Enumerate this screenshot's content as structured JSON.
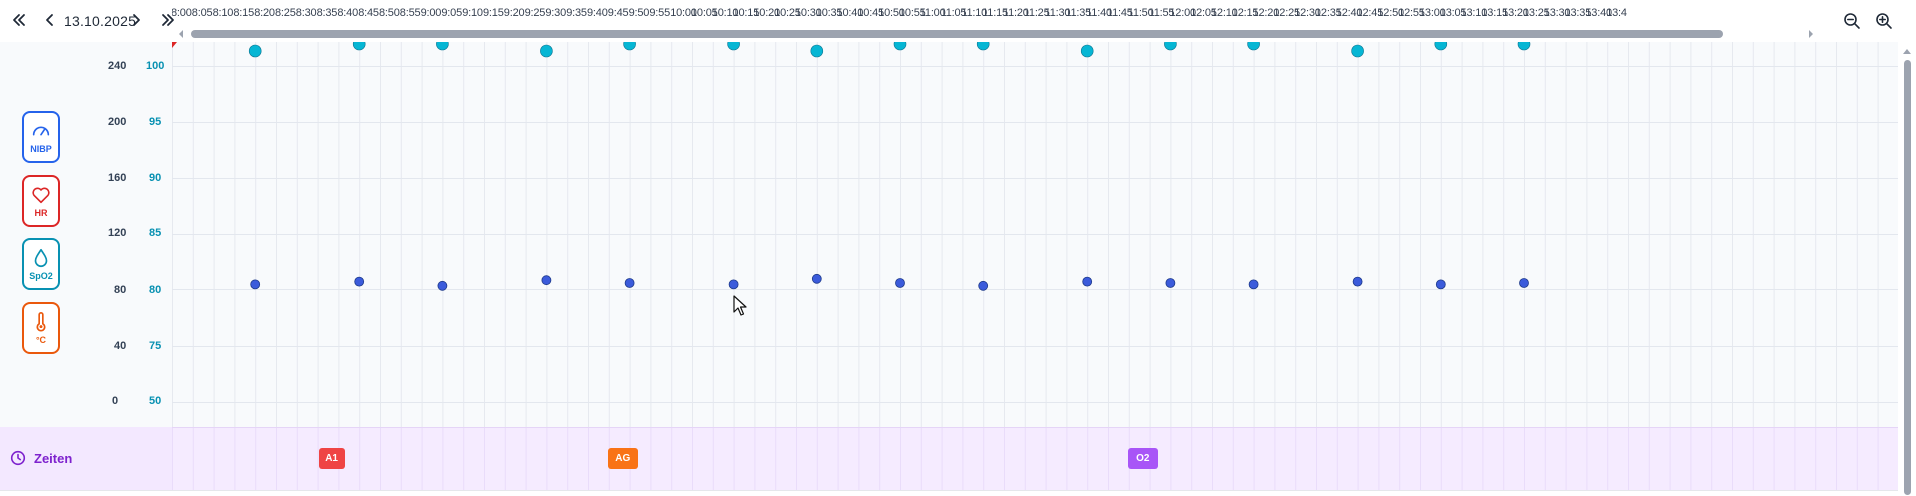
{
  "header": {
    "date": "13.10.2025",
    "prev_page_icon": "double-chevron-left-icon",
    "prev_day_icon": "chevron-left-icon",
    "next_day_icon": "chevron-right-icon",
    "next_page_icon": "double-chevron-right-icon",
    "zoom_out_icon": "zoom-out-icon",
    "zoom_in_icon": "zoom-in-icon"
  },
  "timeline": {
    "ticks": [
      "8:00",
      "8:05",
      "8:10",
      "8:15",
      "8:20",
      "8:25",
      "8:30",
      "8:35",
      "8:40",
      "8:45",
      "8:50",
      "8:55",
      "9:00",
      "9:05",
      "9:10",
      "9:15",
      "9:20",
      "9:25",
      "9:30",
      "9:35",
      "9:40",
      "9:45",
      "9:50",
      "9:55",
      "10:00",
      "10:05",
      "10:10",
      "10:15",
      "10:20",
      "10:25",
      "10:30",
      "10:35",
      "10:40",
      "10:45",
      "10:50",
      "10:55",
      "11:00",
      "11:05",
      "11:10",
      "11:15",
      "11:20",
      "11:25",
      "11:30",
      "11:35",
      "11:40",
      "11:45",
      "11:50",
      "11:55",
      "12:00",
      "12:05",
      "12:10",
      "12:15",
      "12:20",
      "12:25",
      "12:30",
      "12:35",
      "12:40",
      "12:45",
      "12:50",
      "12:55",
      "13:00",
      "13:05",
      "13:10",
      "13:15",
      "13:20",
      "13:25",
      "13:30",
      "13:35",
      "13:40",
      "13:4"
    ]
  },
  "vitals": [
    {
      "label": "NIBP",
      "icon": "gauge-icon",
      "color": "#2563eb"
    },
    {
      "label": "HR",
      "icon": "heart-icon",
      "color": "#dc2626"
    },
    {
      "label": "SpO2",
      "icon": "droplet-icon",
      "color": "#0891b2"
    },
    {
      "label": "°C",
      "icon": "thermometer-icon",
      "color": "#ea580c"
    }
  ],
  "axes": {
    "left": [
      "240",
      "200",
      "160",
      "120",
      "80",
      "40",
      "0"
    ],
    "right": [
      "100",
      "95",
      "90",
      "85",
      "80",
      "75",
      "50"
    ],
    "left_color": "#1f2937",
    "right_color": "#0891b2"
  },
  "series": {
    "spo2_color": "#06b6d4",
    "hr_color": "#3b5bdb",
    "spo2_times": [
      "8:20",
      "8:45",
      "9:05",
      "9:30",
      "9:50",
      "10:15",
      "10:35",
      "10:55",
      "11:15",
      "11:40",
      "12:00",
      "12:20",
      "12:45",
      "13:05",
      "13:25"
    ],
    "hr_times": [
      "8:20",
      "8:45",
      "9:05",
      "9:30",
      "9:50",
      "10:15",
      "10:35",
      "10:55",
      "11:15",
      "11:40",
      "12:00",
      "12:20",
      "12:45",
      "13:05",
      "13:25"
    ],
    "hr_values": [
      84,
      86,
      83,
      87,
      85,
      84,
      88,
      85,
      83,
      86,
      85,
      84,
      86,
      84,
      85
    ]
  },
  "zeiten": {
    "label": "Zeiten",
    "icon": "clock-icon",
    "color": "#7e22ce",
    "markers": [
      {
        "label": "A1",
        "time": "8:35",
        "color": "#ef4444"
      },
      {
        "label": "AG",
        "time": "9:45",
        "color": "#f97316"
      },
      {
        "label": "O2",
        "time": "11:50",
        "color": "#a855f7"
      }
    ]
  }
}
